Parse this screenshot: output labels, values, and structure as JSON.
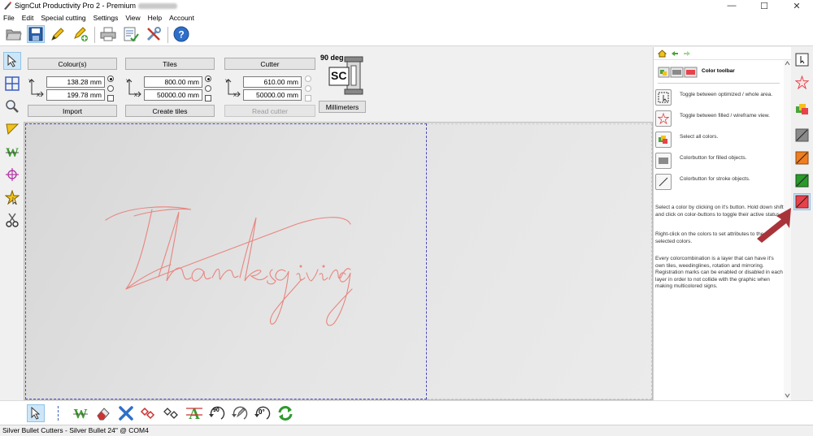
{
  "window": {
    "title": "SignCut Productivity Pro 2 - Premium",
    "minimize": "—",
    "maximize": "☐",
    "close": "✕"
  },
  "menu": [
    "File",
    "Edit",
    "Special cutting",
    "Settings",
    "View",
    "Help",
    "Account"
  ],
  "toolbar": {
    "icons": [
      "open-folder-icon",
      "save-icon",
      "pencil-icon",
      "pencil-add-icon",
      "print-icon",
      "checklist-icon",
      "tools-icon",
      "help-icon"
    ]
  },
  "left_tools": [
    "pointer-icon",
    "tiles-icon",
    "zoom-icon",
    "weed-box-icon",
    "weed-text-icon",
    "crosshair-icon",
    "star-icon",
    "scissors-icon"
  ],
  "settings": {
    "colours": {
      "label": "Colour(s)",
      "width": "138.28 mm",
      "height": "199.78 mm",
      "button": "Import"
    },
    "tiles": {
      "label": "Tiles",
      "width": "800.00 mm",
      "height": "50000.00 mm",
      "button": "Create tiles"
    },
    "cutter": {
      "label": "Cutter",
      "width": "610.00 mm",
      "height": "50000.00 mm",
      "button": "Read cutter"
    },
    "rotation": "90 deg",
    "units_button": "Millimeters",
    "axis_x": "X",
    "axis_y": "Y",
    "logo_text": "SC"
  },
  "canvas": {
    "artwork_text": "Thanksgiving",
    "artwork_color": "#e8857f"
  },
  "bottom_tools": {
    "icons": [
      "pointer-icon",
      "weed-w-icon",
      "eraser-icon",
      "delete-x-icon",
      "nodes-red-icon",
      "nodes-icon",
      "weed-a-icon",
      "rotate-90-icon",
      "rotate-pen-icon",
      "rotate-0-icon",
      "refresh-icon"
    ],
    "rotate90_label": "90",
    "rotate0_label": "0°"
  },
  "status": "Silver Bullet Cutters - Silver Bullet 24\" @ COM4",
  "help": {
    "title": "Color toolbar",
    "items": [
      {
        "icon": "optimize-area-icon",
        "text": "Toggle between optimized / whole area."
      },
      {
        "icon": "star-wireframe-icon",
        "text": "Toggle between filled / wireframe view."
      },
      {
        "icon": "select-colors-icon",
        "text": "Select all colors."
      },
      {
        "icon": "fill-color-icon",
        "text": "Colorbutton for filled objects."
      },
      {
        "icon": "stroke-color-icon",
        "text": "Colorbutton for stroke objects."
      }
    ],
    "para1": "Select a color by clicking on it's button. Hold down shift and click on color-buttons to toggle their active status.",
    "para2": "Right-click on the colors to set attributes to the selected colors.",
    "para3": "Every colorcombination is a layer that can have it's own tiles, weedinglines, rotation and mirroring. Registration marks can be enabled or disabled in each layer in order to not collide with the graphic when making multicolored signs."
  },
  "color_tools": {
    "buttons": [
      "optimize-icon",
      "star-icon",
      "multicolor-icon",
      "gray-color-icon",
      "orange-color-icon",
      "green-color-icon",
      "red-color-icon"
    ],
    "colors": {
      "gray": "#8a8a8a",
      "orange": "#f07d1e",
      "green": "#2a9a2a",
      "red": "#e8424a"
    }
  }
}
